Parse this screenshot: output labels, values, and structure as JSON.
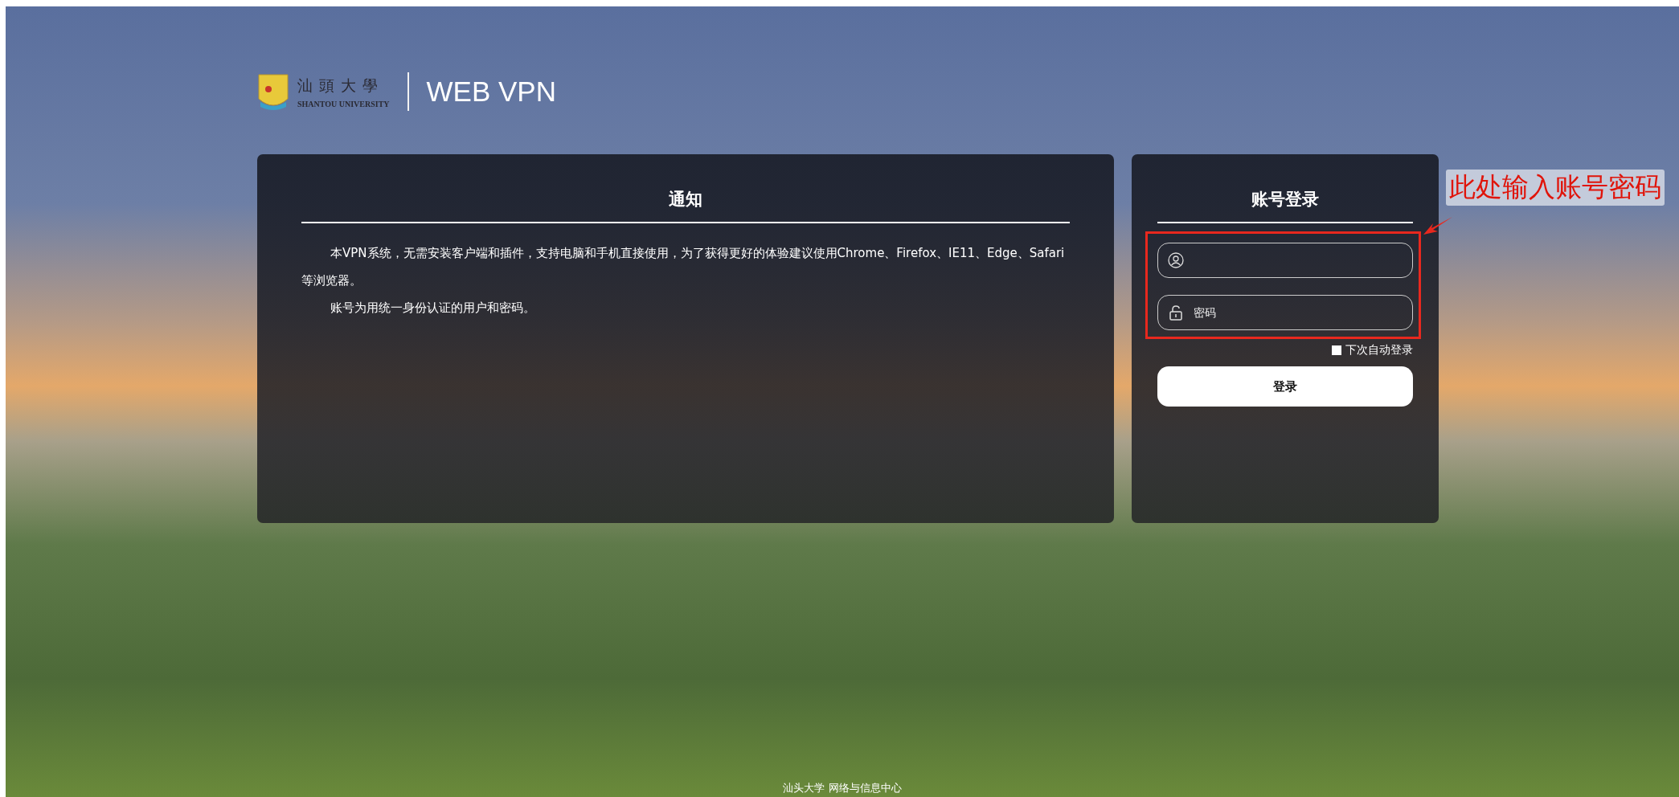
{
  "header": {
    "logo_cn": "汕頭大學",
    "logo_en": "SHANTOU UNIVERSITY",
    "title": "WEB VPN"
  },
  "notice": {
    "title": "通知",
    "paragraphs": [
      "本VPN系统，无需安装客户端和插件，支持电脑和手机直接使用，为了获得更好的体验建议使用Chrome、Firefox、IE11、Edge、Safari等浏览器。",
      "账号为用统一身份认证的用户和密码。"
    ]
  },
  "login": {
    "title": "账号登录",
    "password": {
      "placeholder": "密码"
    },
    "remember": {
      "label": "下次自动登录",
      "checked": false
    },
    "submit": "登录"
  },
  "annotation": {
    "text": "此处输入账号密码"
  },
  "footer": "汕头大学 网络与信息中心"
}
